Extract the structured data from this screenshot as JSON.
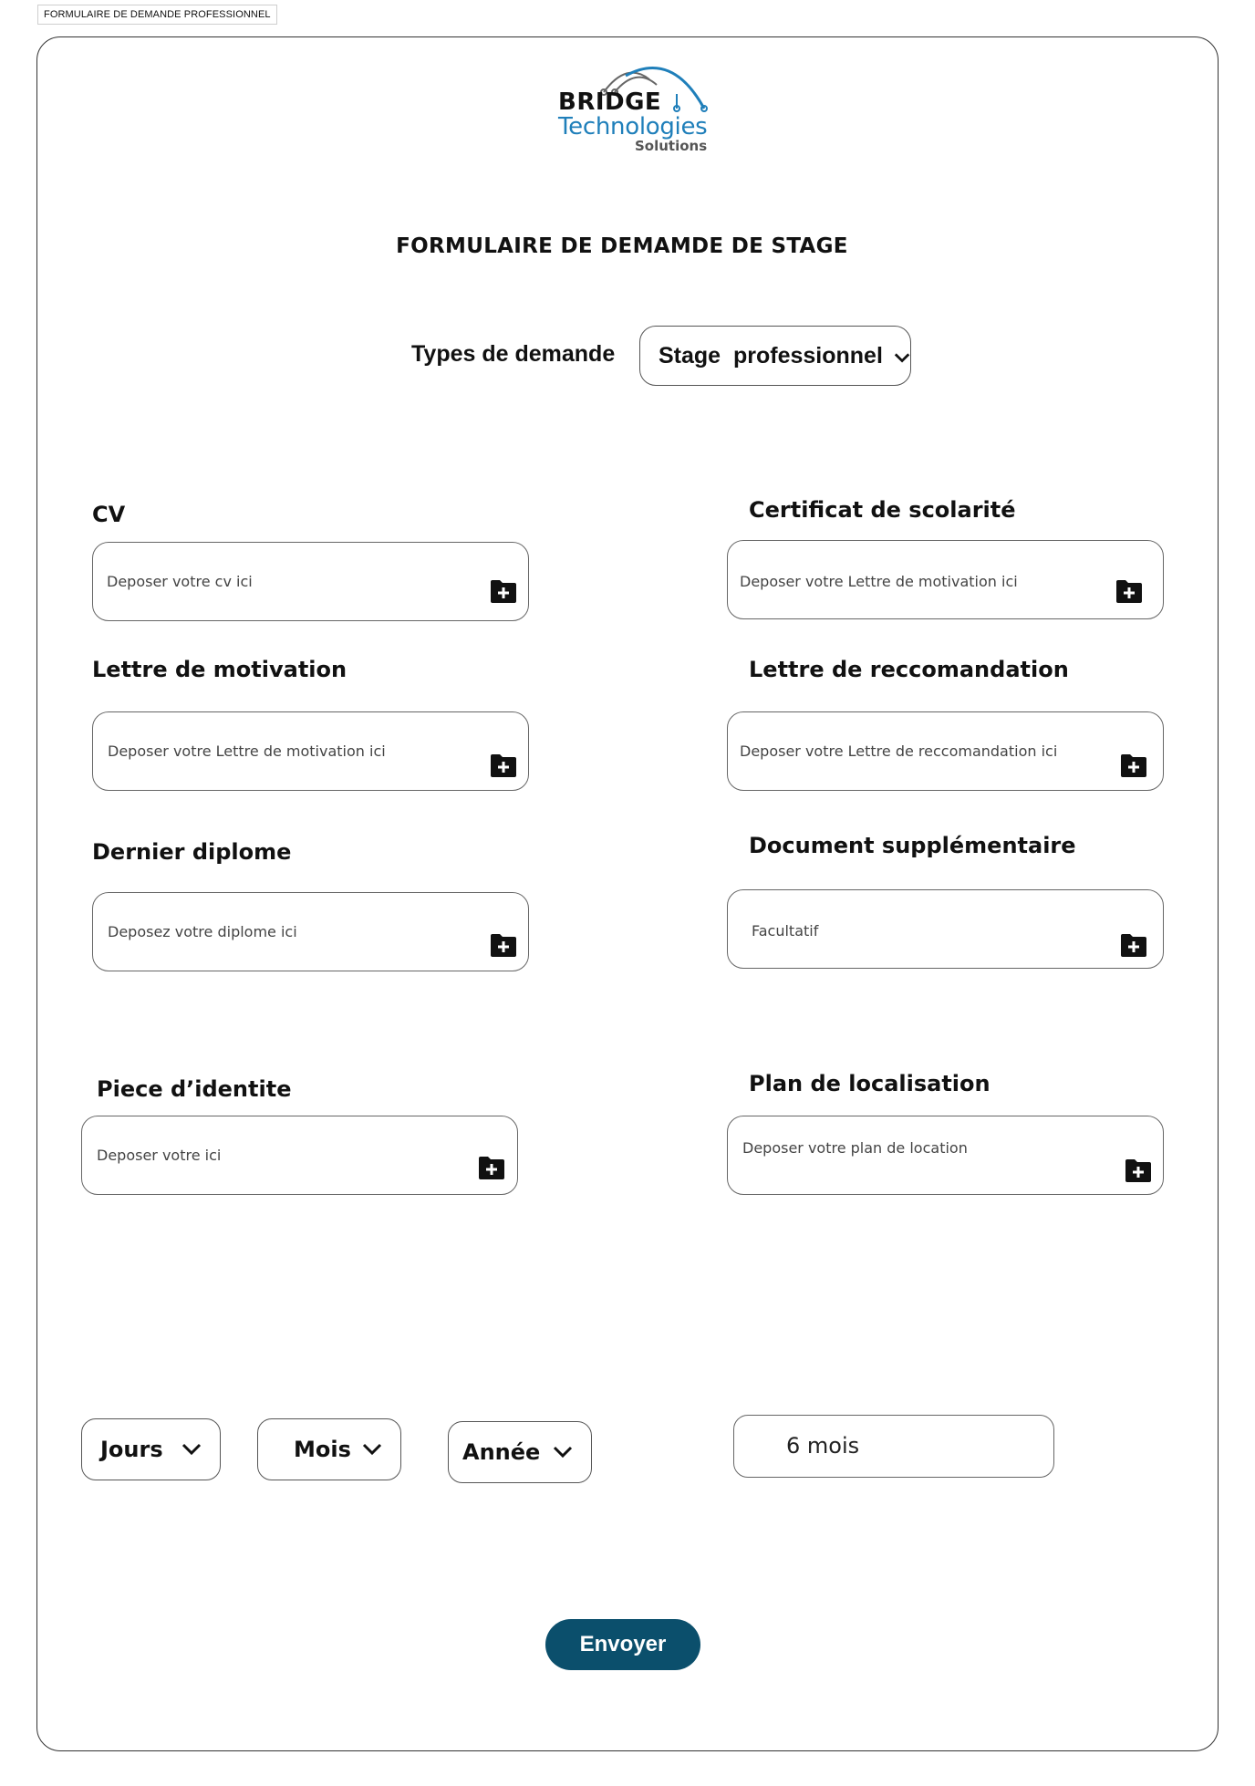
{
  "frame_tag": "FORMULAIRE DE DEMANDE PROFESSIONNEL",
  "logo": {
    "line1": "BRIDGE",
    "line2": "Technologies",
    "line3": "Solutions"
  },
  "title": "FORMULAIRE DE DEMAMDE DE STAGE",
  "request_type": {
    "label": "Types de demande",
    "value": "Stage  professionnel"
  },
  "fields": [
    {
      "label": "CV",
      "placeholder": "Deposer votre cv ici"
    },
    {
      "label": "Certificat de scolarité",
      "placeholder": "Deposer votre Lettre de motivation ici"
    },
    {
      "label": "Lettre de motivation",
      "placeholder": "Deposer votre Lettre de motivation ici"
    },
    {
      "label": "Lettre de reccomandation",
      "placeholder": "Deposer votre Lettre de reccomandation ici"
    },
    {
      "label": "Dernier diplome",
      "placeholder": "Deposez votre diplome ici"
    },
    {
      "label": "Document supplémentaire",
      "placeholder": "Facultatif"
    },
    {
      "label": "Piece d’identite",
      "placeholder": "Deposer votre ici"
    },
    {
      "label": "Plan de localisation",
      "placeholder": "Deposer votre plan de location"
    }
  ],
  "date": {
    "day": "Jours",
    "month": "Mois",
    "year": "Année"
  },
  "duration": "6 mois",
  "submit_label": "Envoyer",
  "icons": {
    "upload": "folder-plus-icon",
    "dropdown": "chevron-down-icon"
  },
  "colors": {
    "brand_blue": "#1f7fba",
    "submit_bg": "#0b4f6c"
  }
}
